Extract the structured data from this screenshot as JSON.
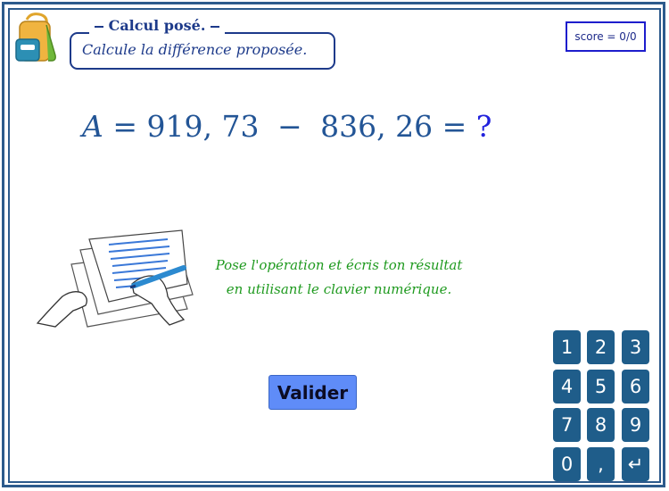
{
  "header": {
    "title": "Calcul posé.",
    "instruction": "Calcule la différence proposée.",
    "score": "score = 0/0"
  },
  "equation": {
    "variable": "A",
    "equals": "=",
    "operand1": "919, 73",
    "operator": "−",
    "operand2": "836, 26",
    "result_placeholder": "?"
  },
  "hint": {
    "line1": "Pose l'opération et écris ton résultat",
    "line2": "en utilisant le clavier numérique."
  },
  "validate_button": {
    "label": "Valider"
  },
  "keypad": {
    "keys": [
      "1",
      "2",
      "3",
      "4",
      "5",
      "6",
      "7",
      "8",
      "9",
      "0",
      ",",
      "↵"
    ]
  },
  "colors": {
    "frame": "#2d5b8c",
    "title": "#1d3a8a",
    "equation": "#235596",
    "hint": "#1f9a1f",
    "button": "#5f8cf8",
    "key": "#1f5d8a"
  },
  "icons": {
    "schoolbag": "schoolbag-icon",
    "illustration": "hands-writing-on-paper"
  }
}
